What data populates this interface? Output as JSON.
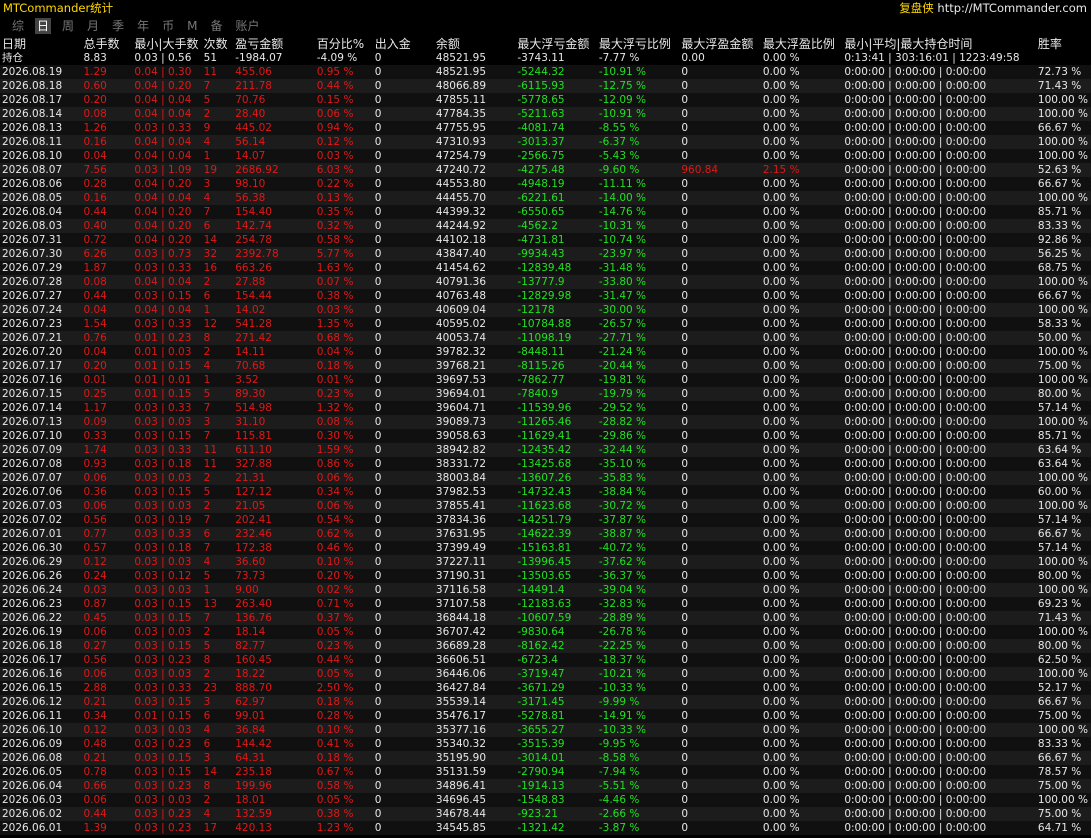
{
  "app": {
    "title": "MTCommander统计",
    "brand_cn": "复盘侠",
    "brand_url": "http://MTCommander.com"
  },
  "tabs": [
    {
      "label": "综",
      "active": false
    },
    {
      "label": "日",
      "active": true
    },
    {
      "label": "周",
      "active": false
    },
    {
      "label": "月",
      "active": false
    },
    {
      "label": "季",
      "active": false
    },
    {
      "label": "年",
      "active": false
    },
    {
      "label": "币",
      "active": false
    },
    {
      "label": "M",
      "active": false
    },
    {
      "label": "备",
      "active": false
    },
    {
      "label": "账户",
      "active": false
    }
  ],
  "columns": [
    "日期",
    "总手数",
    "最小|大手数",
    "次数",
    "盈亏金额",
    "百分比%",
    "出入金",
    "余额",
    "最大浮亏金额",
    "最大浮亏比例",
    "最大浮盈金额",
    "最大浮盈比例",
    "最小|平均|最大持仓时间",
    "胜率"
  ],
  "summary": [
    "持仓",
    "8.83",
    "0.03 | 0.56",
    "51",
    "-1984.07",
    "-4.09 %",
    "0",
    "48521.95",
    "-3743.11",
    "-7.77 %",
    "0.00",
    "0.00 %",
    "0:13:41 | 303:16:01 | 1223:49:58",
    ""
  ],
  "rows": [
    [
      "2026.08.19",
      "1.29",
      "0.04 | 0.30",
      "11",
      "455.06",
      "0.95 %",
      "0",
      "48521.95",
      "-5244.32",
      "-10.91 %",
      "0",
      "0.00 %",
      "0:00:00 | 0:00:00 | 0:00:00",
      "72.73 %"
    ],
    [
      "2026.08.18",
      "0.60",
      "0.04 | 0.20",
      "7",
      "211.78",
      "0.44 %",
      "0",
      "48066.89",
      "-6115.93",
      "-12.75 %",
      "0",
      "0.00 %",
      "0:00:00 | 0:00:00 | 0:00:00",
      "71.43 %"
    ],
    [
      "2026.08.17",
      "0.20",
      "0.04 | 0.04",
      "5",
      "70.76",
      "0.15 %",
      "0",
      "47855.11",
      "-5778.65",
      "-12.09 %",
      "0",
      "0.00 %",
      "0:00:00 | 0:00:00 | 0:00:00",
      "100.00 %"
    ],
    [
      "2026.08.14",
      "0.08",
      "0.04 | 0.04",
      "2",
      "28.40",
      "0.06 %",
      "0",
      "47784.35",
      "-5211.63",
      "-10.91 %",
      "0",
      "0.00 %",
      "0:00:00 | 0:00:00 | 0:00:00",
      "100.00 %"
    ],
    [
      "2026.08.13",
      "1.26",
      "0.03 | 0.33",
      "9",
      "445.02",
      "0.94 %",
      "0",
      "47755.95",
      "-4081.74",
      "-8.55 %",
      "0",
      "0.00 %",
      "0:00:00 | 0:00:00 | 0:00:00",
      "66.67 %"
    ],
    [
      "2026.08.11",
      "0.16",
      "0.04 | 0.04",
      "4",
      "56.14",
      "0.12 %",
      "0",
      "47310.93",
      "-3013.37",
      "-6.37 %",
      "0",
      "0.00 %",
      "0:00:00 | 0:00:00 | 0:00:00",
      "100.00 %"
    ],
    [
      "2026.08.10",
      "0.04",
      "0.04 | 0.04",
      "1",
      "14.07",
      "0.03 %",
      "0",
      "47254.79",
      "-2566.75",
      "-5.43 %",
      "0",
      "0.00 %",
      "0:00:00 | 0:00:00 | 0:00:00",
      "100.00 %"
    ],
    [
      "2026.08.07",
      "7.56",
      "0.03 | 1.09",
      "19",
      "2686.92",
      "6.03 %",
      "0",
      "47240.72",
      "-4275.48",
      "-9.60 %",
      "960.84",
      "2.15 %",
      "0:00:00 | 0:00:00 | 0:00:00",
      "52.63 %"
    ],
    [
      "2026.08.06",
      "0.28",
      "0.04 | 0.20",
      "3",
      "98.10",
      "0.22 %",
      "0",
      "44553.80",
      "-4948.19",
      "-11.11 %",
      "0",
      "0.00 %",
      "0:00:00 | 0:00:00 | 0:00:00",
      "66.67 %"
    ],
    [
      "2026.08.05",
      "0.16",
      "0.04 | 0.04",
      "4",
      "56.38",
      "0.13 %",
      "0",
      "44455.70",
      "-6221.61",
      "-14.00 %",
      "0",
      "0.00 %",
      "0:00:00 | 0:00:00 | 0:00:00",
      "100.00 %"
    ],
    [
      "2026.08.04",
      "0.44",
      "0.04 | 0.20",
      "7",
      "154.40",
      "0.35 %",
      "0",
      "44399.32",
      "-6550.65",
      "-14.76 %",
      "0",
      "0.00 %",
      "0:00:00 | 0:00:00 | 0:00:00",
      "85.71 %"
    ],
    [
      "2026.08.03",
      "0.40",
      "0.04 | 0.20",
      "6",
      "142.74",
      "0.32 %",
      "0",
      "44244.92",
      "-4562.2",
      "-10.31 %",
      "0",
      "0.00 %",
      "0:00:00 | 0:00:00 | 0:00:00",
      "83.33 %"
    ],
    [
      "2026.07.31",
      "0.72",
      "0.04 | 0.20",
      "14",
      "254.78",
      "0.58 %",
      "0",
      "44102.18",
      "-4731.81",
      "-10.74 %",
      "0",
      "0.00 %",
      "0:00:00 | 0:00:00 | 0:00:00",
      "92.86 %"
    ],
    [
      "2026.07.30",
      "6.26",
      "0.03 | 0.73",
      "32",
      "2392.78",
      "5.77 %",
      "0",
      "43847.40",
      "-9934.43",
      "-23.97 %",
      "0",
      "0.00 %",
      "0:00:00 | 0:00:00 | 0:00:00",
      "56.25 %"
    ],
    [
      "2026.07.29",
      "1.87",
      "0.03 | 0.33",
      "16",
      "663.26",
      "1.63 %",
      "0",
      "41454.62",
      "-12839.48",
      "-31.48 %",
      "0",
      "0.00 %",
      "0:00:00 | 0:00:00 | 0:00:00",
      "68.75 %"
    ],
    [
      "2026.07.28",
      "0.08",
      "0.04 | 0.04",
      "2",
      "27.88",
      "0.07 %",
      "0",
      "40791.36",
      "-13777.9",
      "-33.80 %",
      "0",
      "0.00 %",
      "0:00:00 | 0:00:00 | 0:00:00",
      "100.00 %"
    ],
    [
      "2026.07.27",
      "0.44",
      "0.03 | 0.15",
      "6",
      "154.44",
      "0.38 %",
      "0",
      "40763.48",
      "-12829.98",
      "-31.47 %",
      "0",
      "0.00 %",
      "0:00:00 | 0:00:00 | 0:00:00",
      "66.67 %"
    ],
    [
      "2026.07.24",
      "0.04",
      "0.04 | 0.04",
      "1",
      "14.02",
      "0.03 %",
      "0",
      "40609.04",
      "-12178",
      "-30.00 %",
      "0",
      "0.00 %",
      "0:00:00 | 0:00:00 | 0:00:00",
      "100.00 %"
    ],
    [
      "2026.07.23",
      "1.54",
      "0.03 | 0.33",
      "12",
      "541.28",
      "1.35 %",
      "0",
      "40595.02",
      "-10784.88",
      "-26.57 %",
      "0",
      "0.00 %",
      "0:00:00 | 0:00:00 | 0:00:00",
      "58.33 %"
    ],
    [
      "2026.07.21",
      "0.76",
      "0.01 | 0.23",
      "8",
      "271.42",
      "0.68 %",
      "0",
      "40053.74",
      "-11098.19",
      "-27.71 %",
      "0",
      "0.00 %",
      "0:00:00 | 0:00:00 | 0:00:00",
      "50.00 %"
    ],
    [
      "2026.07.20",
      "0.04",
      "0.01 | 0.03",
      "2",
      "14.11",
      "0.04 %",
      "0",
      "39782.32",
      "-8448.11",
      "-21.24 %",
      "0",
      "0.00 %",
      "0:00:00 | 0:00:00 | 0:00:00",
      "100.00 %"
    ],
    [
      "2026.07.17",
      "0.20",
      "0.01 | 0.15",
      "4",
      "70.68",
      "0.18 %",
      "0",
      "39768.21",
      "-8115.26",
      "-20.44 %",
      "0",
      "0.00 %",
      "0:00:00 | 0:00:00 | 0:00:00",
      "75.00 %"
    ],
    [
      "2026.07.16",
      "0.01",
      "0.01 | 0.01",
      "1",
      "3.52",
      "0.01 %",
      "0",
      "39697.53",
      "-7862.77",
      "-19.81 %",
      "0",
      "0.00 %",
      "0:00:00 | 0:00:00 | 0:00:00",
      "100.00 %"
    ],
    [
      "2026.07.15",
      "0.25",
      "0.01 | 0.15",
      "5",
      "89.30",
      "0.23 %",
      "0",
      "39694.01",
      "-7840.9",
      "-19.79 %",
      "0",
      "0.00 %",
      "0:00:00 | 0:00:00 | 0:00:00",
      "80.00 %"
    ],
    [
      "2026.07.14",
      "1.17",
      "0.03 | 0.33",
      "7",
      "514.98",
      "1.32 %",
      "0",
      "39604.71",
      "-11539.96",
      "-29.52 %",
      "0",
      "0.00 %",
      "0:00:00 | 0:00:00 | 0:00:00",
      "57.14 %"
    ],
    [
      "2026.07.13",
      "0.09",
      "0.03 | 0.03",
      "3",
      "31.10",
      "0.08 %",
      "0",
      "39089.73",
      "-11265.46",
      "-28.82 %",
      "0",
      "0.00 %",
      "0:00:00 | 0:00:00 | 0:00:00",
      "100.00 %"
    ],
    [
      "2026.07.10",
      "0.33",
      "0.03 | 0.15",
      "7",
      "115.81",
      "0.30 %",
      "0",
      "39058.63",
      "-11629.41",
      "-29.86 %",
      "0",
      "0.00 %",
      "0:00:00 | 0:00:00 | 0:00:00",
      "85.71 %"
    ],
    [
      "2026.07.09",
      "1.74",
      "0.03 | 0.33",
      "11",
      "611.10",
      "1.59 %",
      "0",
      "38942.82",
      "-12435.42",
      "-32.44 %",
      "0",
      "0.00 %",
      "0:00:00 | 0:00:00 | 0:00:00",
      "63.64 %"
    ],
    [
      "2026.07.08",
      "0.93",
      "0.03 | 0.18",
      "11",
      "327.88",
      "0.86 %",
      "0",
      "38331.72",
      "-13425.68",
      "-35.10 %",
      "0",
      "0.00 %",
      "0:00:00 | 0:00:00 | 0:00:00",
      "63.64 %"
    ],
    [
      "2026.07.07",
      "0.06",
      "0.03 | 0.03",
      "2",
      "21.31",
      "0.06 %",
      "0",
      "38003.84",
      "-13607.26",
      "-35.83 %",
      "0",
      "0.00 %",
      "0:00:00 | 0:00:00 | 0:00:00",
      "100.00 %"
    ],
    [
      "2026.07.06",
      "0.36",
      "0.03 | 0.15",
      "5",
      "127.12",
      "0.34 %",
      "0",
      "37982.53",
      "-14732.43",
      "-38.84 %",
      "0",
      "0.00 %",
      "0:00:00 | 0:00:00 | 0:00:00",
      "60.00 %"
    ],
    [
      "2026.07.03",
      "0.06",
      "0.03 | 0.03",
      "2",
      "21.05",
      "0.06 %",
      "0",
      "37855.41",
      "-11623.68",
      "-30.72 %",
      "0",
      "0.00 %",
      "0:00:00 | 0:00:00 | 0:00:00",
      "100.00 %"
    ],
    [
      "2026.07.02",
      "0.56",
      "0.03 | 0.19",
      "7",
      "202.41",
      "0.54 %",
      "0",
      "37834.36",
      "-14251.79",
      "-37.87 %",
      "0",
      "0.00 %",
      "0:00:00 | 0:00:00 | 0:00:00",
      "57.14 %"
    ],
    [
      "2026.07.01",
      "0.77",
      "0.03 | 0.33",
      "6",
      "232.46",
      "0.62 %",
      "0",
      "37631.95",
      "-14622.39",
      "-38.87 %",
      "0",
      "0.00 %",
      "0:00:00 | 0:00:00 | 0:00:00",
      "66.67 %"
    ],
    [
      "2026.06.30",
      "0.57",
      "0.03 | 0.18",
      "7",
      "172.38",
      "0.46 %",
      "0",
      "37399.49",
      "-15163.81",
      "-40.72 %",
      "0",
      "0.00 %",
      "0:00:00 | 0:00:00 | 0:00:00",
      "57.14 %"
    ],
    [
      "2026.06.29",
      "0.12",
      "0.03 | 0.03",
      "4",
      "36.60",
      "0.10 %",
      "0",
      "37227.11",
      "-13996.45",
      "-37.62 %",
      "0",
      "0.00 %",
      "0:00:00 | 0:00:00 | 0:00:00",
      "100.00 %"
    ],
    [
      "2026.06.26",
      "0.24",
      "0.03 | 0.12",
      "5",
      "73.73",
      "0.20 %",
      "0",
      "37190.31",
      "-13503.65",
      "-36.37 %",
      "0",
      "0.00 %",
      "0:00:00 | 0:00:00 | 0:00:00",
      "80.00 %"
    ],
    [
      "2026.06.24",
      "0.03",
      "0.03 | 0.03",
      "1",
      "9.00",
      "0.02 %",
      "0",
      "37116.58",
      "-14491.4",
      "-39.04 %",
      "0",
      "0.00 %",
      "0:00:00 | 0:00:00 | 0:00:00",
      "100.00 %"
    ],
    [
      "2026.06.23",
      "0.87",
      "0.03 | 0.15",
      "13",
      "263.40",
      "0.71 %",
      "0",
      "37107.58",
      "-12183.63",
      "-32.83 %",
      "0",
      "0.00 %",
      "0:00:00 | 0:00:00 | 0:00:00",
      "69.23 %"
    ],
    [
      "2026.06.22",
      "0.45",
      "0.03 | 0.15",
      "7",
      "136.76",
      "0.37 %",
      "0",
      "36844.18",
      "-10607.59",
      "-28.89 %",
      "0",
      "0.00 %",
      "0:00:00 | 0:00:00 | 0:00:00",
      "71.43 %"
    ],
    [
      "2026.06.19",
      "0.06",
      "0.03 | 0.03",
      "2",
      "18.14",
      "0.05 %",
      "0",
      "36707.42",
      "-9830.64",
      "-26.78 %",
      "0",
      "0.00 %",
      "0:00:00 | 0:00:00 | 0:00:00",
      "100.00 %"
    ],
    [
      "2026.06.18",
      "0.27",
      "0.03 | 0.15",
      "5",
      "82.77",
      "0.23 %",
      "0",
      "36689.28",
      "-8162.42",
      "-22.25 %",
      "0",
      "0.00 %",
      "0:00:00 | 0:00:00 | 0:00:00",
      "80.00 %"
    ],
    [
      "2026.06.17",
      "0.56",
      "0.03 | 0.23",
      "8",
      "160.45",
      "0.44 %",
      "0",
      "36606.51",
      "-6723.4",
      "-18.37 %",
      "0",
      "0.00 %",
      "0:00:00 | 0:00:00 | 0:00:00",
      "62.50 %"
    ],
    [
      "2026.06.16",
      "0.06",
      "0.03 | 0.03",
      "2",
      "18.22",
      "0.05 %",
      "0",
      "36446.06",
      "-3719.47",
      "-10.21 %",
      "0",
      "0.00 %",
      "0:00:00 | 0:00:00 | 0:00:00",
      "100.00 %"
    ],
    [
      "2026.06.15",
      "2.88",
      "0.03 | 0.33",
      "23",
      "888.70",
      "2.50 %",
      "0",
      "36427.84",
      "-3671.29",
      "-10.33 %",
      "0",
      "0.00 %",
      "0:00:00 | 0:00:00 | 0:00:00",
      "52.17 %"
    ],
    [
      "2026.06.12",
      "0.21",
      "0.03 | 0.15",
      "3",
      "62.97",
      "0.18 %",
      "0",
      "35539.14",
      "-3171.45",
      "-9.99 %",
      "0",
      "0.00 %",
      "0:00:00 | 0:00:00 | 0:00:00",
      "66.67 %"
    ],
    [
      "2026.06.11",
      "0.34",
      "0.01 | 0.15",
      "6",
      "99.01",
      "0.28 %",
      "0",
      "35476.17",
      "-5278.81",
      "-14.91 %",
      "0",
      "0.00 %",
      "0:00:00 | 0:00:00 | 0:00:00",
      "75.00 %"
    ],
    [
      "2026.06.10",
      "0.12",
      "0.03 | 0.03",
      "4",
      "36.84",
      "0.10 %",
      "0",
      "35377.16",
      "-3655.27",
      "-10.33 %",
      "0",
      "0.00 %",
      "0:00:00 | 0:00:00 | 0:00:00",
      "100.00 %"
    ],
    [
      "2026.06.09",
      "0.48",
      "0.03 | 0.23",
      "6",
      "144.42",
      "0.41 %",
      "0",
      "35340.32",
      "-3515.39",
      "-9.95 %",
      "0",
      "0.00 %",
      "0:00:00 | 0:00:00 | 0:00:00",
      "83.33 %"
    ],
    [
      "2026.06.08",
      "0.21",
      "0.03 | 0.15",
      "3",
      "64.31",
      "0.18 %",
      "0",
      "35195.90",
      "-3014.01",
      "-8.58 %",
      "0",
      "0.00 %",
      "0:00:00 | 0:00:00 | 0:00:00",
      "66.67 %"
    ],
    [
      "2026.06.05",
      "0.78",
      "0.03 | 0.15",
      "14",
      "235.18",
      "0.67 %",
      "0",
      "35131.59",
      "-2790.94",
      "-7.94 %",
      "0",
      "0.00 %",
      "0:00:00 | 0:00:00 | 0:00:00",
      "78.57 %"
    ],
    [
      "2026.06.04",
      "0.66",
      "0.03 | 0.23",
      "8",
      "199.96",
      "0.58 %",
      "0",
      "34896.41",
      "-1914.13",
      "-5.51 %",
      "0",
      "0.00 %",
      "0:00:00 | 0:00:00 | 0:00:00",
      "75.00 %"
    ],
    [
      "2026.06.03",
      "0.06",
      "0.03 | 0.03",
      "2",
      "18.01",
      "0.05 %",
      "0",
      "34696.45",
      "-1548.83",
      "-4.46 %",
      "0",
      "0.00 %",
      "0:00:00 | 0:00:00 | 0:00:00",
      "100.00 %"
    ],
    [
      "2026.06.02",
      "0.44",
      "0.03 | 0.23",
      "4",
      "132.59",
      "0.38 %",
      "0",
      "34678.44",
      "-923.21",
      "-2.66 %",
      "0",
      "0.00 %",
      "0:00:00 | 0:00:00 | 0:00:00",
      "75.00 %"
    ],
    [
      "2026.06.01",
      "1.39",
      "0.03 | 0.23",
      "17",
      "420.13",
      "1.23 %",
      "0",
      "34545.85",
      "-1321.42",
      "-3.87 %",
      "0",
      "0.00 %",
      "0:00:00 | 0:00:00 | 0:00:00",
      "64.71 %"
    ]
  ],
  "colors": {
    "background": "#000000",
    "positive": "#e01818",
    "negative": "#22e022",
    "text": "#e8e8e8",
    "title": "#ffd700"
  }
}
